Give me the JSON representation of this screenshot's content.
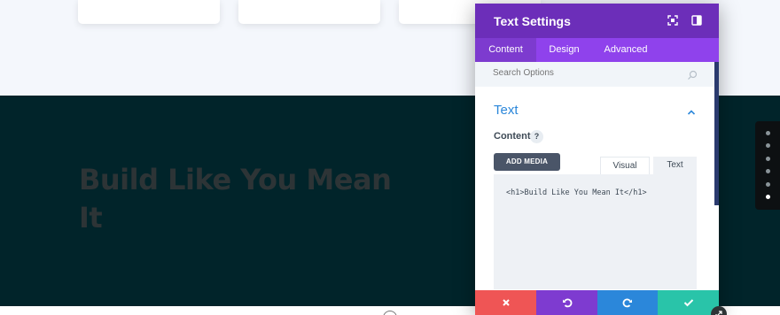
{
  "hero": {
    "title": "Build Like You Mean It"
  },
  "settings_panel": {
    "title": "Text Settings",
    "header_icons": [
      "screenshot-icon",
      "sidebar-toggle-icon"
    ],
    "tabs": [
      {
        "label": "Content",
        "active": true
      },
      {
        "label": "Design",
        "active": false
      },
      {
        "label": "Advanced",
        "active": false
      }
    ],
    "search": {
      "placeholder": "Search Options",
      "value": ""
    },
    "section": {
      "title": "Text",
      "expanded": true
    },
    "content_field": {
      "label": "Content",
      "help": "?",
      "add_media_label": "ADD MEDIA",
      "editor_tabs": [
        {
          "label": "Visual",
          "active": false
        },
        {
          "label": "Text",
          "active": true
        }
      ],
      "value": "<h1>Build Like You Mean It</h1>"
    },
    "footer_buttons": [
      {
        "action": "cancel",
        "icon": "close-icon"
      },
      {
        "action": "undo",
        "icon": "undo-icon"
      },
      {
        "action": "redo",
        "icon": "redo-icon"
      },
      {
        "action": "save",
        "icon": "check-icon"
      }
    ]
  },
  "dot_navigation": {
    "count": 6,
    "active_index": 5
  },
  "colors": {
    "panel_header": "#6c2eb9",
    "panel_tabs": "#8f42ec",
    "hero_bg": "#01242a",
    "accent_blue": "#2b87da",
    "cancel": "#ef5555",
    "undo": "#7e3bd0",
    "redo": "#2b87da",
    "save": "#29c4a9"
  }
}
